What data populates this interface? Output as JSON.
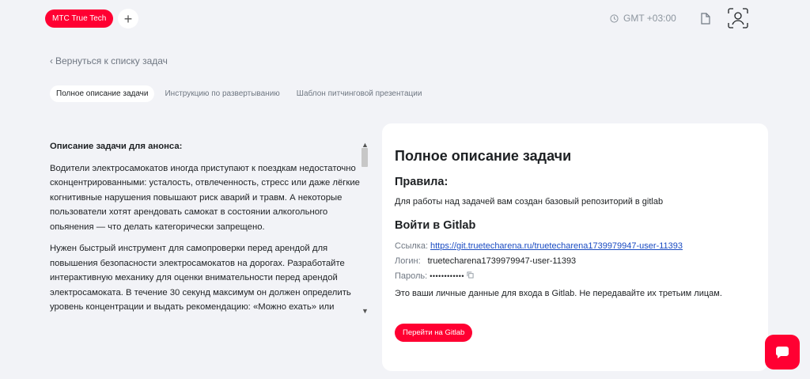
{
  "header": {
    "brand_label": "МТС True Tech",
    "add_label": "+",
    "timezone": "GMT +03:00"
  },
  "nav": {
    "back_label": "Вернуться к списку задач"
  },
  "tabs": [
    {
      "label": "Полное описание задачи",
      "active": true
    },
    {
      "label": "Инструкцию по развертыванию",
      "active": false
    },
    {
      "label": "Шаблон питчинговой презентации",
      "active": false
    }
  ],
  "description": {
    "heading": "Описание задачи для анонса:",
    "p1": "Водители электросамокатов иногда приступают к поездкам недостаточно сконцентрированными: усталость, отвлеченность, стресс или даже лёгкие когнитивные нарушения повышают риск аварий и травм. А некоторые пользователи хотят арендовать самокат в состоянии алкогольного опьянения — что делать категорически запрещено.",
    "p2": "Нужен быстрый инструмент для самопроверки перед арендой для повышения безопасности электросамокатов на дорогах. Разработайте интерактивную механику для оценки внимательности перед арендой электросамоката. В течение 30 секунд максимум он должен определить уровень концентрации и выдать рекомендацию: «Можно ехать» или"
  },
  "card": {
    "title": "Полное описание задачи",
    "rules_title": "Правила:",
    "rules_text": "Для работы над задачей вам создан базовый репозиторий в gitlab",
    "gitlab_title": "Войти в Gitlab",
    "link_label": "Ссылка:",
    "link_value": "https://git.truetecharena.ru/truetecharena1739979947-user-11393",
    "login_label": "Логин:",
    "login_value": "truetecharena1739979947-user-11393",
    "password_label": "Пароль:",
    "password_value": "••••••••••••",
    "notice": "Это ваши личные данные для входа в Gitlab. Не передавайте их третьим лицам.",
    "button_label": "Перейти на Gitlab"
  },
  "colors": {
    "accent": "#ff0032",
    "link": "#1a4bc2",
    "background": "#f2f3f7"
  }
}
